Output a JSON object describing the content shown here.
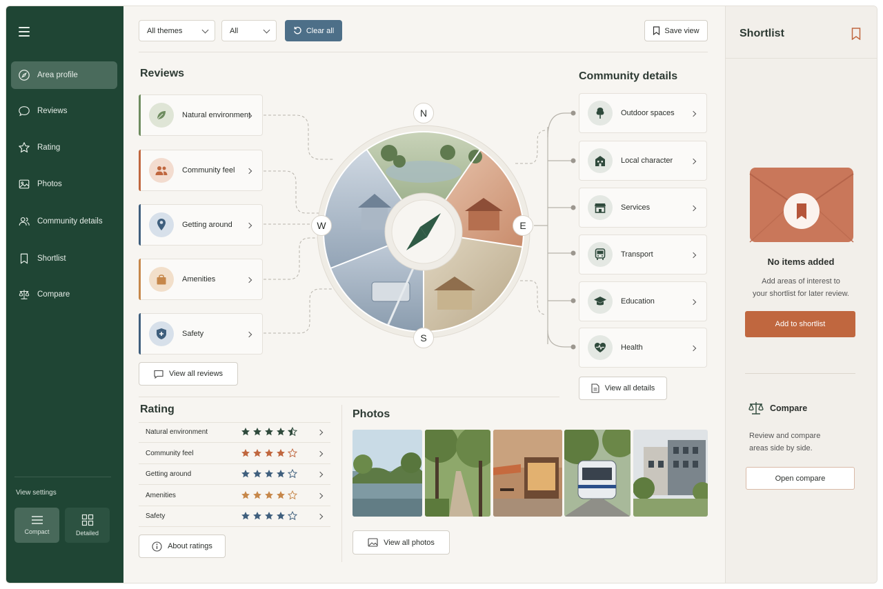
{
  "sidebar": {
    "items": [
      {
        "label": "Area profile",
        "icon": "compass-icon",
        "active": true
      },
      {
        "label": "Reviews",
        "icon": "chat-bubble-icon"
      },
      {
        "label": "Rating",
        "icon": "star-icon"
      },
      {
        "label": "Photos",
        "icon": "image-icon"
      },
      {
        "label": "Community details",
        "icon": "people-icon"
      },
      {
        "label": "Shortlist",
        "icon": "bookmark-icon"
      },
      {
        "label": "Compare",
        "icon": "scales-icon"
      }
    ],
    "view_settings": {
      "label": "View settings",
      "compact": "Compact",
      "detailed": "Detailed",
      "selected": "Compact"
    }
  },
  "toolbar": {
    "theme_filter": "All themes",
    "second_filter": "All",
    "clear_label": "Clear all",
    "save_label": "Save view"
  },
  "reviews": {
    "title": "Reviews",
    "cards": [
      {
        "label": "Natural environment",
        "color": "#6e8c5f"
      },
      {
        "label": "Community feel",
        "color": "#c0673f"
      },
      {
        "label": "Getting around",
        "color": "#3f5f7d"
      },
      {
        "label": "Amenities",
        "color": "#c6874a"
      },
      {
        "label": "Safety",
        "color": "#3f5f7d"
      }
    ],
    "view_all": "View all reviews"
  },
  "compass": {
    "n": "N",
    "e": "E",
    "s": "S",
    "w": "W"
  },
  "community": {
    "title": "Community details",
    "items": [
      {
        "label": "Outdoor spaces",
        "icon": "tree-icon"
      },
      {
        "label": "Local character",
        "icon": "building-icon"
      },
      {
        "label": "Services",
        "icon": "storefront-icon"
      },
      {
        "label": "Transport",
        "icon": "bus-icon"
      },
      {
        "label": "Education",
        "icon": "graduation-cap-icon"
      },
      {
        "label": "Health",
        "icon": "heart-pulse-icon"
      }
    ],
    "view_all": "View all details"
  },
  "rating": {
    "title": "Rating",
    "rows": [
      {
        "label": "Natural environment",
        "stars": 4.5,
        "color": "#2f4a3c"
      },
      {
        "label": "Community feel",
        "stars": 4,
        "color": "#c0673f"
      },
      {
        "label": "Getting around",
        "stars": 4,
        "color": "#3f5f7d"
      },
      {
        "label": "Amenities",
        "stars": 4,
        "color": "#c6874a"
      },
      {
        "label": "Safety",
        "stars": 4,
        "color": "#3f5f7d"
      }
    ],
    "about": "About ratings"
  },
  "photos": {
    "title": "Photos",
    "view_all": "View all photos"
  },
  "shortlist": {
    "title": "Shortlist",
    "empty_title": "No items added",
    "empty_text": [
      "Add areas of interest to",
      "your shortlist for later review."
    ],
    "add_button": "Add to shortlist"
  },
  "compare": {
    "title": "Compare",
    "text": [
      "Review and compare",
      "areas side by side."
    ],
    "button": "Open compare"
  },
  "colors": {
    "sidebar": "#1f4534",
    "accent": "#c0673f",
    "blue": "#4d6f88"
  }
}
